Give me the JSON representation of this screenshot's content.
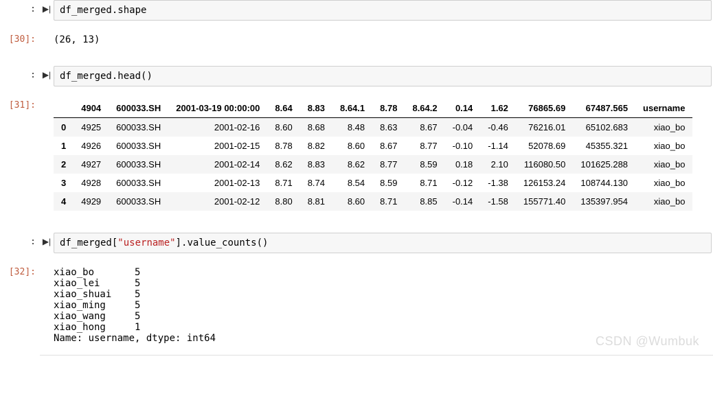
{
  "cells": {
    "c1": {
      "in_prompt": ":",
      "out_prompt": "[30]:",
      "code_tokens": [
        {
          "t": "df_merged",
          "cls": "fn"
        },
        {
          "t": ".",
          "cls": ""
        },
        {
          "t": "shape",
          "cls": ""
        }
      ],
      "output_text": "(26, 13)"
    },
    "c2": {
      "in_prompt": ":",
      "out_prompt": "[31]:",
      "code_tokens": [
        {
          "t": "df_merged",
          "cls": "fn"
        },
        {
          "t": ".",
          "cls": ""
        },
        {
          "t": "head",
          "cls": ""
        },
        {
          "t": "()",
          "cls": ""
        }
      ]
    },
    "c3": {
      "in_prompt": ":",
      "out_prompt": "[32]:",
      "code_tokens": [
        {
          "t": "df_merged",
          "cls": "fn"
        },
        {
          "t": "[",
          "cls": ""
        },
        {
          "t": "\"username\"",
          "cls": "str"
        },
        {
          "t": "]",
          "cls": ""
        },
        {
          "t": ".",
          "cls": ""
        },
        {
          "t": "value_counts",
          "cls": ""
        },
        {
          "t": "()",
          "cls": ""
        }
      ],
      "output_text": "xiao_bo       5\nxiao_lei      5\nxiao_shuai    5\nxiao_ming     5\nxiao_wang     5\nxiao_hong     1\nName: username, dtype: int64"
    }
  },
  "table": {
    "columns": [
      "",
      "4904",
      "600033.SH",
      "2001-03-19 00:00:00",
      "8.64",
      "8.83",
      "8.64.1",
      "8.78",
      "8.64.2",
      "0.14",
      "1.62",
      "76865.69",
      "67487.565",
      "username"
    ],
    "rows": [
      [
        "0",
        "4925",
        "600033.SH",
        "2001-02-16",
        "8.60",
        "8.68",
        "8.48",
        "8.63",
        "8.67",
        "-0.04",
        "-0.46",
        "76216.01",
        "65102.683",
        "xiao_bo"
      ],
      [
        "1",
        "4926",
        "600033.SH",
        "2001-02-15",
        "8.78",
        "8.82",
        "8.60",
        "8.67",
        "8.77",
        "-0.10",
        "-1.14",
        "52078.69",
        "45355.321",
        "xiao_bo"
      ],
      [
        "2",
        "4927",
        "600033.SH",
        "2001-02-14",
        "8.62",
        "8.83",
        "8.62",
        "8.77",
        "8.59",
        "0.18",
        "2.10",
        "116080.50",
        "101625.288",
        "xiao_bo"
      ],
      [
        "3",
        "4928",
        "600033.SH",
        "2001-02-13",
        "8.71",
        "8.74",
        "8.54",
        "8.59",
        "8.71",
        "-0.12",
        "-1.38",
        "126153.24",
        "108744.130",
        "xiao_bo"
      ],
      [
        "4",
        "4929",
        "600033.SH",
        "2001-02-12",
        "8.80",
        "8.81",
        "8.60",
        "8.71",
        "8.85",
        "-0.14",
        "-1.58",
        "155771.40",
        "135397.954",
        "xiao_bo"
      ]
    ]
  },
  "watermark": "CSDN @Wumbuk",
  "icons": {
    "run": "▶|"
  }
}
